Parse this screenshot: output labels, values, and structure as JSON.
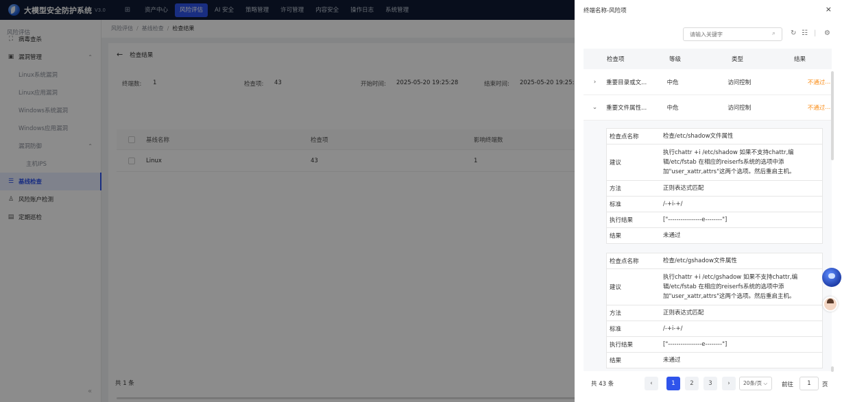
{
  "app": {
    "title": "大模型安全防护系统",
    "version": "V3.0"
  },
  "topnav": [
    "资产中心",
    "风险评估",
    "AI 安全",
    "策略管理",
    "许可管理",
    "内容安全",
    "操作日志",
    "系统管理"
  ],
  "sidebar": {
    "header": "风险评估",
    "items": [
      {
        "label": "病毒查杀"
      },
      {
        "label": "漏洞管理"
      },
      {
        "label": "Linux系统漏洞"
      },
      {
        "label": "Linux应用漏洞"
      },
      {
        "label": "Windows系统漏洞"
      },
      {
        "label": "Windows应用漏洞"
      },
      {
        "label": "漏洞防御"
      },
      {
        "label": "主机IPS"
      },
      {
        "label": "基线检查"
      },
      {
        "label": "风险账户检测"
      },
      {
        "label": "定期巡检"
      }
    ],
    "collapse_glyph": "«"
  },
  "breadcrumb": [
    "风险评估",
    "基线检查",
    "检查结果"
  ],
  "page": {
    "back_title": "检查结果",
    "stats": {
      "terminals_label": "终端数:",
      "terminals": "1",
      "items_label": "检查项:",
      "items": "43",
      "start_label": "开始时间:",
      "start": "2025-05-20 19:25:28",
      "end_label": "结束时间:",
      "end": "2025-05-20 19:25:"
    },
    "table": {
      "columns": [
        "基线名称",
        "检查项",
        "影响终端数"
      ],
      "rows": [
        {
          "name": "Linux",
          "items": "43",
          "terminals": "1"
        }
      ]
    },
    "total": "共 1 条"
  },
  "drawer": {
    "title": "终端名称-风险项",
    "close": "×",
    "search_placeholder": "请输入关键字",
    "columns": [
      "检查项",
      "等级",
      "类型",
      "结果"
    ],
    "rows": [
      {
        "expander": "›",
        "item": "重要目录或文...",
        "level": "中危",
        "type": "访问控制",
        "result": "不通过",
        "more": "..."
      },
      {
        "expander": "⌄",
        "item": "重要文件属性...",
        "level": "中危",
        "type": "访问控制",
        "result": "不通过",
        "more": "..."
      }
    ],
    "details": [
      {
        "name_k": "检查点名称",
        "name_v": "检查/etc/shadow文件属性",
        "advice_k": "建议",
        "advice_v": "执行chattr +i /etc/shadow 如果不支持chattr,编辑/etc/fstab 在相应的reiserfs系统的选项中添加\"user_xattr,attrs\"这两个选项。然后重启主机。",
        "method_k": "方法",
        "method_v": "正则表达式匹配",
        "std_k": "标准",
        "std_v": "/-+i-+/",
        "exec_k": "执行结果",
        "exec_v": "[\"----------------e--------\"]",
        "res_k": "结果",
        "res_v": "未通过"
      },
      {
        "name_k": "检查点名称",
        "name_v": "检查/etc/gshadow文件属性",
        "advice_k": "建议",
        "advice_v": "执行chattr +i /etc/gshadow 如果不支持chattr,编辑/etc/fstab 在相应的reiserfs系统的选项中添加\"user_xattr,attrs\"这两个选项。然后重启主机。",
        "method_k": "方法",
        "method_v": "正则表达式匹配",
        "std_k": "标准",
        "std_v": "/-+i-+/",
        "exec_k": "执行结果",
        "exec_v": "[\"----------------e--------\"]",
        "res_k": "结果",
        "res_v": "未通过"
      }
    ],
    "pager": {
      "total": "共 43 条",
      "prev": "‹",
      "pages": [
        "1",
        "2",
        "3"
      ],
      "next": "›",
      "size": "20条/页 ⌵",
      "goto": "前往",
      "goto_value": "1",
      "page_suffix": "页"
    }
  },
  "colors": {
    "primary": "#2f54eb",
    "topbar": "#0f1b33",
    "warning": "#fa8c16"
  }
}
